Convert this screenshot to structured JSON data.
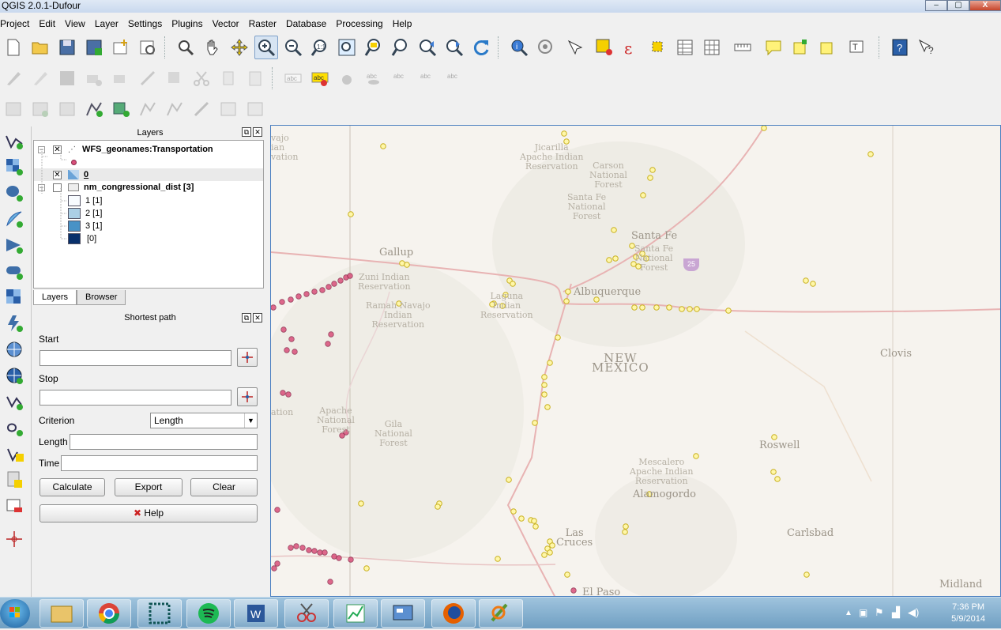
{
  "window": {
    "title": "QGIS 2.0.1-Dufour",
    "min": "–",
    "max": "▢",
    "close": "X"
  },
  "menu": [
    "Project",
    "Edit",
    "View",
    "Layer",
    "Settings",
    "Plugins",
    "Vector",
    "Raster",
    "Database",
    "Processing",
    "Help"
  ],
  "layers_panel": {
    "title": "Layers",
    "items": [
      {
        "name": "WFS_geonames:Transportation",
        "checked": true
      },
      {
        "name": "0",
        "checked": true
      },
      {
        "name": "nm_congressional_dist [3]",
        "checked": false
      }
    ],
    "legend": [
      {
        "label": "1 [1]",
        "color": "#f7fbff"
      },
      {
        "label": "2 [1]",
        "color": "#abcfe5"
      },
      {
        "label": "3 [1]",
        "color": "#4892c6"
      },
      {
        "label": "[0]",
        "color": "#08306b"
      }
    ],
    "point_color": "#d94f7a"
  },
  "tabs": {
    "layers": "Layers",
    "browser": "Browser"
  },
  "shortest_path": {
    "title": "Shortest path",
    "start_label": "Start",
    "stop_label": "Stop",
    "criterion_label": "Criterion",
    "criterion_value": "Length",
    "length_label": "Length",
    "time_label": "Time",
    "calculate": "Calculate",
    "export": "Export",
    "clear": "Clear",
    "help": "Help"
  },
  "map": {
    "labels": {
      "jicarilla": "Jicarilla\nApache Indian\nReservation",
      "carson": "Carson\nNational\nForest",
      "santafe_nf": "Santa Fe\nNational\nForest",
      "santafe_nf2": "Santa Fe\nNational\nForest",
      "santafe": "Santa Fe",
      "gallup": "Gallup",
      "zuni": "Zuni Indian\nReservation",
      "laguna": "Laguna\nIndian\nReservation",
      "ramah": "Ramah Navajo\nIndian\nReservation",
      "albuquerque": "Albuquerque",
      "newmexico": "NEW\nMEXICO",
      "clovis": "Clovis",
      "apache_nf": "Apache\nNational\nForest",
      "gila": "Gila\nNational\nForest",
      "roswell": "Roswell",
      "mescalero": "Mescalero\nApache Indian\nReservation",
      "alamogordo": "Alamogordo",
      "lascruces": "Las\nCruces",
      "carlsbad": "Carlsbad",
      "elpaso": "El Paso",
      "midland": "Midland",
      "navajo": "vajo\nian\nvation",
      "ation": "ation",
      "i25": "25"
    }
  },
  "clock": {
    "time": "7:36 PM",
    "date": "5/9/2014"
  }
}
